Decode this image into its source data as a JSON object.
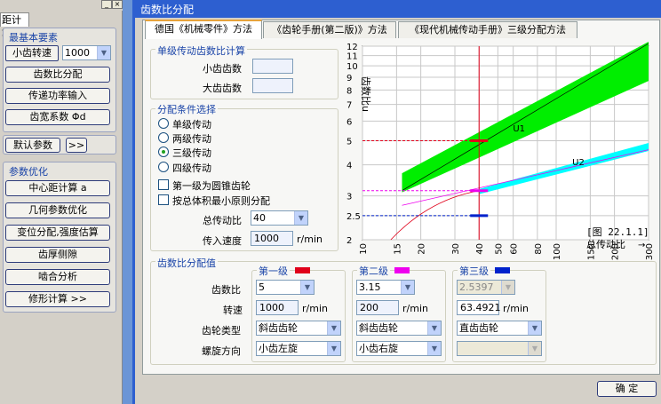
{
  "left_panel": {
    "tab_label": "距计算",
    "group1": {
      "title": "最基本要素",
      "speed_label": "小齿转速",
      "speed_value": "1000",
      "btn1": "齿数比分配",
      "btn2": "传递功率输入",
      "btn3": "齿宽系数 Φd"
    },
    "default_params": "默认参数",
    "expand": ">>",
    "group2": {
      "title": "参数优化",
      "btn1": "中心距计算 a",
      "btn2": "几何参数优化",
      "btn3": "变位分配,强度估算",
      "btn4": "齿厚侧隙",
      "btn5": "啮合分析",
      "btn6": "修形计算  >>"
    }
  },
  "window": {
    "title": "齿数比分配",
    "tabs": [
      "德国《机械零件》方法",
      "《齿轮手册(第二版)》方法",
      "《现代机械传动手册》三级分配方法"
    ],
    "single": {
      "title": "单级传动齿数比计算",
      "small_teeth": "小齿齿数",
      "big_teeth": "大齿齿数",
      "small_value": "",
      "big_value": ""
    },
    "conditions": {
      "title": "分配条件选择",
      "options": [
        "单级传动",
        "两级传动",
        "三级传动",
        "四级传动"
      ],
      "selected": 2,
      "cb1": "第一级为圆锥齿轮",
      "cb2": "按总体积最小原则分配",
      "total_ratio_label": "总传动比",
      "total_ratio_value": "40",
      "input_speed_label": "传入速度",
      "input_speed_value": "1000",
      "unit": "r/min"
    },
    "dist": {
      "title": "齿数比分配值",
      "stages": [
        {
          "name": "第一级",
          "color": "#e0001a",
          "ratio": "5",
          "speed": "1000",
          "gear": "斜齿齿轮",
          "helix": "小齿左旋",
          "disabled": false
        },
        {
          "name": "第二级",
          "color": "#ee00ee",
          "ratio": "3.15",
          "speed": "200",
          "gear": "斜齿齿轮",
          "helix": "小齿右旋",
          "disabled": false
        },
        {
          "name": "第三级",
          "color": "#0022cc",
          "ratio": "2.5397",
          "speed": "63.4921",
          "gear": "直齿齿轮",
          "helix": "",
          "disabled": true
        }
      ],
      "row_ratio": "齿数比",
      "row_speed": "转速",
      "row_gear": "齿轮类型",
      "row_helix": "螺旋方向",
      "unit": "r/min"
    },
    "ok": "确  定"
  },
  "chart_data": {
    "type": "area",
    "ylabel": "齿数比u",
    "xlabel": "总传动比",
    "caption": "[图 22.1.1]",
    "x_ticks": [
      10,
      15,
      20,
      30,
      40,
      50,
      60,
      80,
      100,
      150,
      200,
      300
    ],
    "y_ticks": [
      2,
      2.5,
      3,
      4,
      5,
      6,
      7,
      8,
      9,
      10,
      11,
      12
    ],
    "y_tick_labels": [
      "2",
      "2.5",
      "3",
      "4",
      "5",
      "6",
      "7",
      "8",
      "9",
      "10",
      "11",
      "12"
    ],
    "xlim": [
      10,
      300
    ],
    "ylim": [
      2,
      12
    ],
    "scale": "log",
    "series": [
      {
        "name": "U1",
        "color": "#00ee00",
        "x": [
          16,
          300
        ],
        "lower": [
          3.1,
          8.7
        ],
        "upper": [
          3.7,
          12.5
        ]
      },
      {
        "name": "U2",
        "color": "#00ffff",
        "x": [
          40,
          300
        ],
        "lower": [
          3.05,
          4.55
        ],
        "upper": [
          3.2,
          4.9
        ]
      }
    ],
    "marker_x": 40,
    "markers": [
      {
        "y": 5,
        "color": "#e0001a"
      },
      {
        "y": 3.15,
        "color": "#ee00ee"
      },
      {
        "y": 2.5,
        "color": "#0022cc"
      }
    ]
  }
}
